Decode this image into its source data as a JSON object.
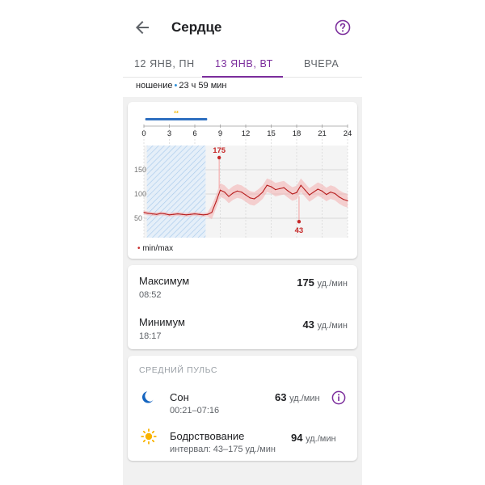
{
  "header": {
    "title": "Сердце",
    "back_icon": "arrow-left-icon",
    "help_icon": "help-circle-icon",
    "accent_color": "#7b2d9c"
  },
  "tabs": [
    {
      "label": "12 ЯНВ, ПН",
      "selected": false
    },
    {
      "label": "13 ЯНВ, ВТ",
      "selected": true
    },
    {
      "label": "ВЧЕРА",
      "selected": false
    }
  ],
  "wear": {
    "label": "ношение",
    "value": "23 ч 59 мин"
  },
  "chart_data": {
    "type": "line",
    "title": "",
    "xlabel": "",
    "ylabel": "",
    "x_ticks": [
      "0",
      "3",
      "6",
      "9",
      "12",
      "15",
      "18",
      "21",
      "24"
    ],
    "y_ticks": [
      "150",
      "100",
      "50"
    ],
    "xlim": [
      0,
      24
    ],
    "ylim": [
      10,
      200
    ],
    "sleep_interval_hours": [
      0.35,
      7.27
    ],
    "sleep_icon": "zzz-icon",
    "max_point": {
      "x": 8.87,
      "y": 175,
      "label": "175"
    },
    "min_point": {
      "x": 18.28,
      "y": 43,
      "label": "43"
    },
    "series": [
      {
        "name": "",
        "color": "#b71c1c",
        "x": [
          0,
          0.5,
          1,
          1.5,
          2,
          2.5,
          3,
          3.5,
          4,
          4.5,
          5,
          5.5,
          6,
          6.5,
          7,
          7.5,
          8,
          8.5,
          9,
          9.5,
          10,
          10.5,
          11,
          11.5,
          12,
          12.5,
          13,
          13.5,
          14,
          14.5,
          15,
          15.5,
          16,
          16.5,
          17,
          17.5,
          18,
          18.5,
          19,
          19.5,
          20,
          20.5,
          21,
          21.5,
          22,
          22.5,
          23,
          23.5,
          24
        ],
        "y": [
          62,
          60,
          59,
          58,
          60,
          59,
          57,
          58,
          59,
          58,
          57,
          58,
          59,
          58,
          57,
          58,
          62,
          84,
          108,
          104,
          95,
          102,
          106,
          104,
          98,
          92,
          90,
          96,
          104,
          118,
          115,
          109,
          111,
          113,
          106,
          100,
          103,
          118,
          108,
          98,
          104,
          110,
          106,
          99,
          104,
          101,
          94,
          89,
          86
        ]
      }
    ],
    "legend": "min/max",
    "grid": true
  },
  "stats": {
    "max": {
      "label": "Максимум",
      "time": "08:52",
      "value": "175",
      "unit": "уд./мин"
    },
    "min": {
      "label": "Минимум",
      "time": "18:17",
      "value": "43",
      "unit": "уд./мин"
    }
  },
  "average": {
    "section_title": "Средний пульс",
    "sleep": {
      "icon": "moon-icon",
      "label": "Сон",
      "range": "00:21–07:16",
      "value": "63",
      "unit": "уд./мин",
      "info_icon": "info-icon"
    },
    "awake": {
      "icon": "sun-icon",
      "label": "Бодрствование",
      "range": "интервал: 43–175 уд./мин",
      "value": "94",
      "unit": "уд./мин"
    }
  }
}
